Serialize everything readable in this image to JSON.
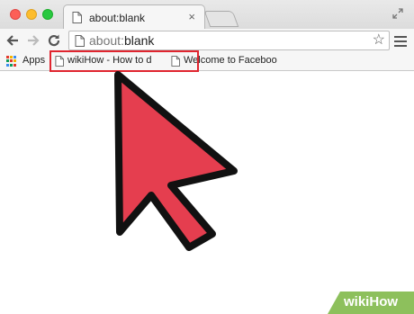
{
  "window": {
    "tab_title": "about:blank",
    "tab_close": "×"
  },
  "toolbar": {
    "address_host": "about:",
    "address_path": "blank",
    "star": "☆"
  },
  "bookmarks": {
    "apps_label": "Apps",
    "items": [
      {
        "label": "wikiHow - How to d"
      },
      {
        "label": "Welcome to Faceboo"
      }
    ]
  },
  "colors": {
    "cursor_fill": "#e53e4f",
    "cursor_outline": "#111111",
    "highlight": "#e0252f",
    "badge_bg": "#8dc05c"
  },
  "icons": [
    "page-icon",
    "back-arrow-icon",
    "forward-arrow-icon",
    "reload-icon",
    "star-icon",
    "menu-icon",
    "apps-grid-icon",
    "fullscreen-icon",
    "mouse-cursor-icon"
  ],
  "watermark": {
    "part1": "wiki",
    "part2": "How"
  }
}
